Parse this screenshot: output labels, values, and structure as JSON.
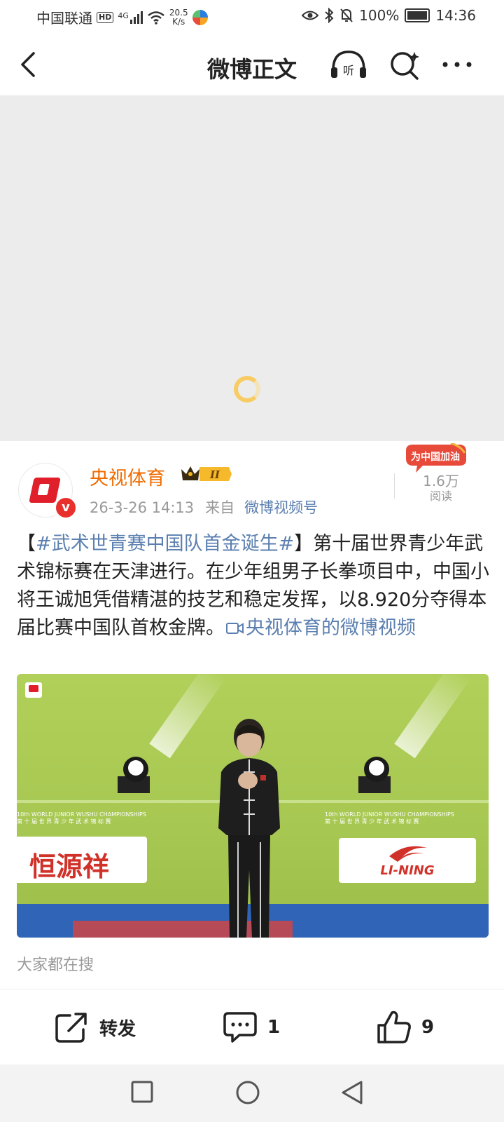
{
  "status_bar": {
    "carrier": "中国联通",
    "hd_badge": "HD",
    "network": "4G",
    "speed_value": "20.5",
    "speed_unit": "K/s",
    "battery_pct": "100%",
    "time": "14:36"
  },
  "nav": {
    "title": "微博正文"
  },
  "post": {
    "author": "央视体育",
    "level_badge": "II",
    "verified_badge": "v",
    "date": "26-3-26 14:13",
    "from_label": "来自",
    "source": "微博视频号",
    "cheer_badge": "为中国加油",
    "reads_count": "1.6万",
    "reads_label": "阅读",
    "text": {
      "bracket_open": "【",
      "topic": "#武术世青赛中国队首金诞生#",
      "body": "】第十届世界青少年武术锦标赛在天津进行。在少年组男子长拳项目中，中国小将王诚旭凭借精湛的技艺和稳定发挥，以8.920分夺得本届比赛中国队首枚金牌。",
      "video_link": "央视体育的微博视频"
    },
    "thumbnail": {
      "event_en": "10th WORLD JUNIOR WUSHU CHAMPIONSHIPS",
      "event_cn": "第 十 届 世 界 青 少 年 武 术 锦 标 赛",
      "sponsor_left": "恒源祥",
      "sponsor_right": "LI-NING"
    }
  },
  "search_section": {
    "label": "大家都在搜"
  },
  "actions": {
    "repost_label": "转发",
    "comment_count": "1",
    "like_count": "9"
  },
  "colors": {
    "link": "#5b7fb0",
    "author": "#f06b00",
    "verified": "#e8312d"
  }
}
